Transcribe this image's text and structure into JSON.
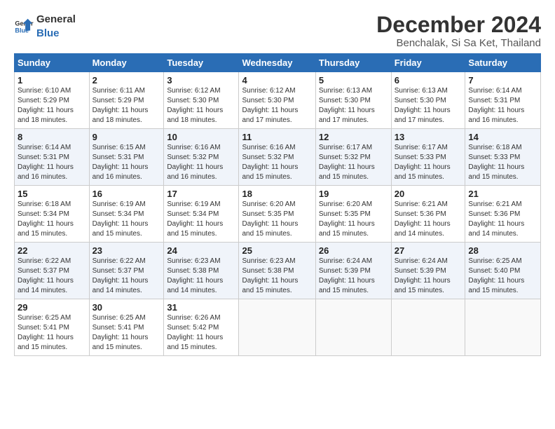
{
  "logo": {
    "line1": "General",
    "line2": "Blue"
  },
  "title": "December 2024",
  "subtitle": "Benchalak, Si Sa Ket, Thailand",
  "weekdays": [
    "Sunday",
    "Monday",
    "Tuesday",
    "Wednesday",
    "Thursday",
    "Friday",
    "Saturday"
  ],
  "weeks": [
    [
      {
        "day": "1",
        "info": "Sunrise: 6:10 AM\nSunset: 5:29 PM\nDaylight: 11 hours\nand 18 minutes."
      },
      {
        "day": "2",
        "info": "Sunrise: 6:11 AM\nSunset: 5:29 PM\nDaylight: 11 hours\nand 18 minutes."
      },
      {
        "day": "3",
        "info": "Sunrise: 6:12 AM\nSunset: 5:30 PM\nDaylight: 11 hours\nand 18 minutes."
      },
      {
        "day": "4",
        "info": "Sunrise: 6:12 AM\nSunset: 5:30 PM\nDaylight: 11 hours\nand 17 minutes."
      },
      {
        "day": "5",
        "info": "Sunrise: 6:13 AM\nSunset: 5:30 PM\nDaylight: 11 hours\nand 17 minutes."
      },
      {
        "day": "6",
        "info": "Sunrise: 6:13 AM\nSunset: 5:30 PM\nDaylight: 11 hours\nand 17 minutes."
      },
      {
        "day": "7",
        "info": "Sunrise: 6:14 AM\nSunset: 5:31 PM\nDaylight: 11 hours\nand 16 minutes."
      }
    ],
    [
      {
        "day": "8",
        "info": "Sunrise: 6:14 AM\nSunset: 5:31 PM\nDaylight: 11 hours\nand 16 minutes."
      },
      {
        "day": "9",
        "info": "Sunrise: 6:15 AM\nSunset: 5:31 PM\nDaylight: 11 hours\nand 16 minutes."
      },
      {
        "day": "10",
        "info": "Sunrise: 6:16 AM\nSunset: 5:32 PM\nDaylight: 11 hours\nand 16 minutes."
      },
      {
        "day": "11",
        "info": "Sunrise: 6:16 AM\nSunset: 5:32 PM\nDaylight: 11 hours\nand 15 minutes."
      },
      {
        "day": "12",
        "info": "Sunrise: 6:17 AM\nSunset: 5:32 PM\nDaylight: 11 hours\nand 15 minutes."
      },
      {
        "day": "13",
        "info": "Sunrise: 6:17 AM\nSunset: 5:33 PM\nDaylight: 11 hours\nand 15 minutes."
      },
      {
        "day": "14",
        "info": "Sunrise: 6:18 AM\nSunset: 5:33 PM\nDaylight: 11 hours\nand 15 minutes."
      }
    ],
    [
      {
        "day": "15",
        "info": "Sunrise: 6:18 AM\nSunset: 5:34 PM\nDaylight: 11 hours\nand 15 minutes."
      },
      {
        "day": "16",
        "info": "Sunrise: 6:19 AM\nSunset: 5:34 PM\nDaylight: 11 hours\nand 15 minutes."
      },
      {
        "day": "17",
        "info": "Sunrise: 6:19 AM\nSunset: 5:34 PM\nDaylight: 11 hours\nand 15 minutes."
      },
      {
        "day": "18",
        "info": "Sunrise: 6:20 AM\nSunset: 5:35 PM\nDaylight: 11 hours\nand 15 minutes."
      },
      {
        "day": "19",
        "info": "Sunrise: 6:20 AM\nSunset: 5:35 PM\nDaylight: 11 hours\nand 15 minutes."
      },
      {
        "day": "20",
        "info": "Sunrise: 6:21 AM\nSunset: 5:36 PM\nDaylight: 11 hours\nand 14 minutes."
      },
      {
        "day": "21",
        "info": "Sunrise: 6:21 AM\nSunset: 5:36 PM\nDaylight: 11 hours\nand 14 minutes."
      }
    ],
    [
      {
        "day": "22",
        "info": "Sunrise: 6:22 AM\nSunset: 5:37 PM\nDaylight: 11 hours\nand 14 minutes."
      },
      {
        "day": "23",
        "info": "Sunrise: 6:22 AM\nSunset: 5:37 PM\nDaylight: 11 hours\nand 14 minutes."
      },
      {
        "day": "24",
        "info": "Sunrise: 6:23 AM\nSunset: 5:38 PM\nDaylight: 11 hours\nand 14 minutes."
      },
      {
        "day": "25",
        "info": "Sunrise: 6:23 AM\nSunset: 5:38 PM\nDaylight: 11 hours\nand 15 minutes."
      },
      {
        "day": "26",
        "info": "Sunrise: 6:24 AM\nSunset: 5:39 PM\nDaylight: 11 hours\nand 15 minutes."
      },
      {
        "day": "27",
        "info": "Sunrise: 6:24 AM\nSunset: 5:39 PM\nDaylight: 11 hours\nand 15 minutes."
      },
      {
        "day": "28",
        "info": "Sunrise: 6:25 AM\nSunset: 5:40 PM\nDaylight: 11 hours\nand 15 minutes."
      }
    ],
    [
      {
        "day": "29",
        "info": "Sunrise: 6:25 AM\nSunset: 5:41 PM\nDaylight: 11 hours\nand 15 minutes."
      },
      {
        "day": "30",
        "info": "Sunrise: 6:25 AM\nSunset: 5:41 PM\nDaylight: 11 hours\nand 15 minutes."
      },
      {
        "day": "31",
        "info": "Sunrise: 6:26 AM\nSunset: 5:42 PM\nDaylight: 11 hours\nand 15 minutes."
      },
      {
        "day": "",
        "info": ""
      },
      {
        "day": "",
        "info": ""
      },
      {
        "day": "",
        "info": ""
      },
      {
        "day": "",
        "info": ""
      }
    ]
  ]
}
